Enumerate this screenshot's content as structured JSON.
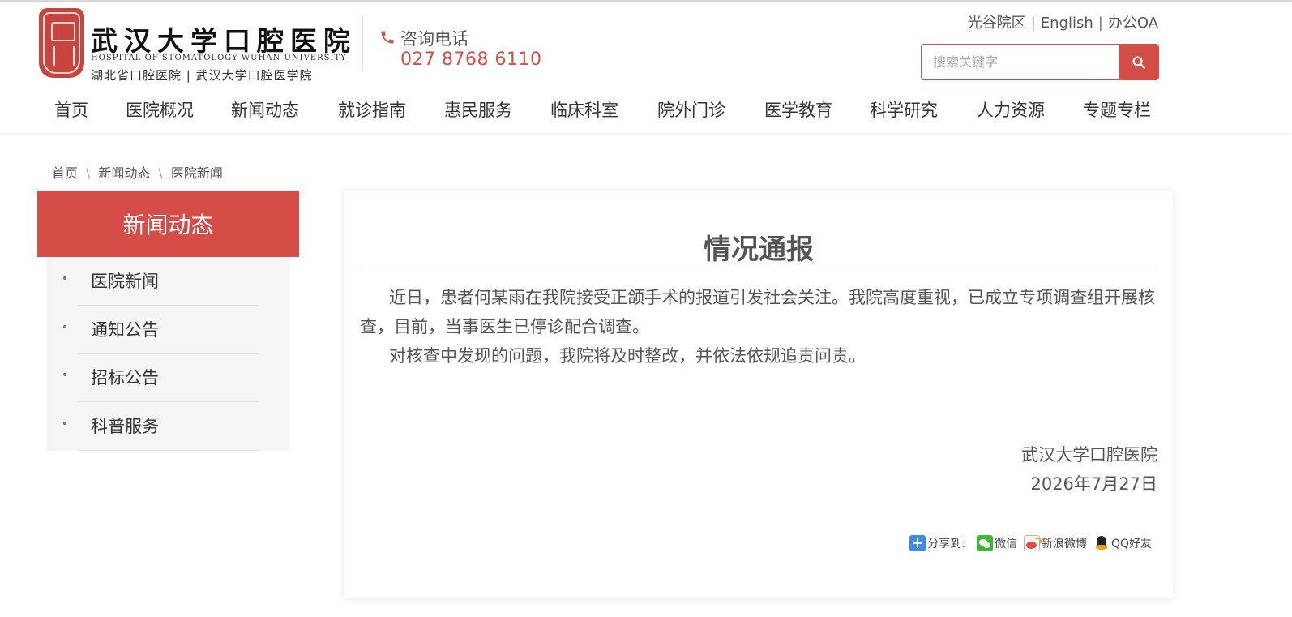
{
  "header": {
    "logo": {
      "seal_text": "口腔",
      "name_cn": "武汉大学口腔医院",
      "name_en": "HOSPITAL OF STOMATOLOGY WUHAN UNIVERSITY",
      "subtitle": "湖北省口腔医院 | 武汉大学口腔医学院"
    },
    "phone": {
      "label": "咨询电话",
      "number": "027 8768 6110"
    },
    "top_links": [
      "光谷院区",
      "English",
      "办公OA"
    ],
    "search": {
      "placeholder": "搜索关键字",
      "value": ""
    },
    "nav": [
      "首页",
      "医院概况",
      "新闻动态",
      "就诊指南",
      "惠民服务",
      "临床科室",
      "院外门诊",
      "医学教育",
      "科学研究",
      "人力资源",
      "专题专栏"
    ]
  },
  "breadcrumb": [
    "首页",
    "新闻动态",
    "医院新闻"
  ],
  "sidebar": {
    "title": "新闻动态",
    "items": [
      "医院新闻",
      "通知公告",
      "招标公告",
      "科普服务"
    ]
  },
  "article": {
    "title": "情况通报",
    "paragraphs": [
      "近日，患者何某雨在我院接受正颌手术的报道引发社会关注。我院高度重视，已成立专项调查组开展核查，目前，当事医生已停诊配合调查。",
      "对核查中发现的问题，我院将及时整改，并依法依规追责问责。"
    ],
    "signature": "武汉大学口腔医院",
    "date": "2026年7月27日"
  },
  "share": {
    "label": "分享到:",
    "targets": [
      "微信",
      "新浪微博",
      "QQ好友"
    ]
  },
  "colors": {
    "accent": "#d44d47",
    "text": "#555555",
    "sidebar_bg": "#f5f5f5"
  }
}
